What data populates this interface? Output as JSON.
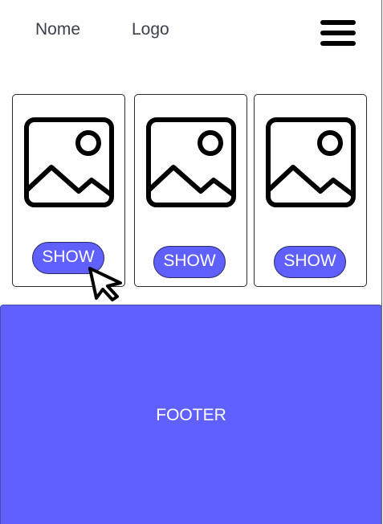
{
  "header": {
    "name_label": "Nome",
    "logo_label": "Logo",
    "menu_icon": "hamburger-menu-icon"
  },
  "cards": [
    {
      "image_icon": "image-placeholder-icon",
      "button_label": "SHOW"
    },
    {
      "image_icon": "image-placeholder-icon",
      "button_label": "SHOW"
    },
    {
      "image_icon": "image-placeholder-icon",
      "button_label": "SHOW"
    }
  ],
  "footer": {
    "label": "FOOTER"
  },
  "colors": {
    "accent": "#6060ff",
    "text": "#3a3f4a",
    "footer_text": "#ffffff"
  }
}
